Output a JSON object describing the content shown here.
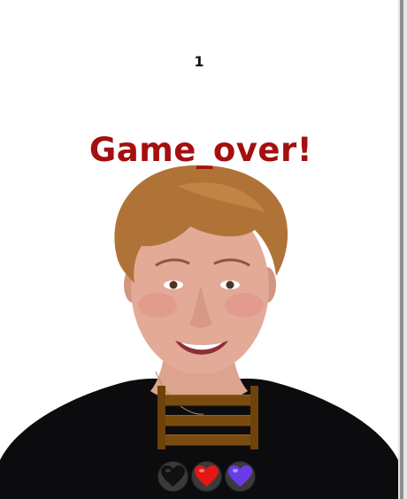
{
  "game": {
    "score": "1",
    "status_text": "Game_over!"
  },
  "colors": {
    "status_text": "#a50f0f",
    "crate": "#7a4b0e",
    "heart_black": "#111111",
    "heart_red": "#e51616",
    "heart_purple": "#6a3ce8"
  },
  "hearts": [
    {
      "name": "black-heart-icon",
      "color": "black"
    },
    {
      "name": "red-heart-icon",
      "color": "red"
    },
    {
      "name": "purple-heart-icon",
      "color": "purple"
    }
  ]
}
